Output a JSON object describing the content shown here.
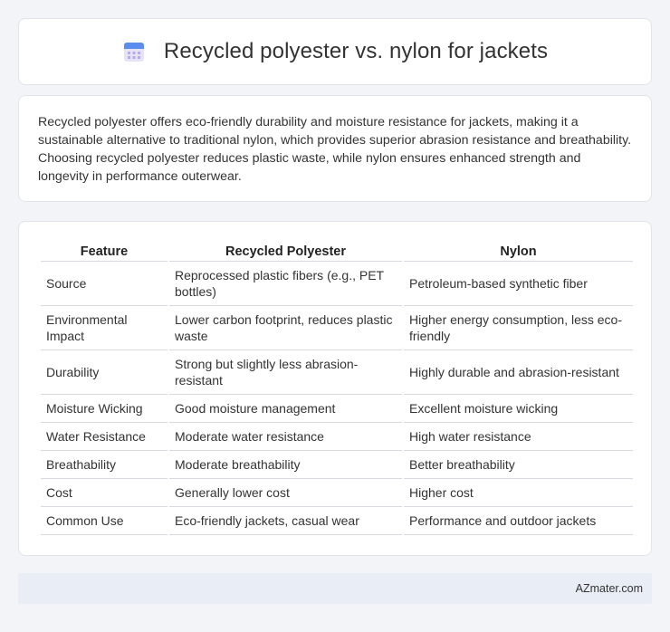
{
  "header": {
    "title": "Recycled polyester vs. nylon for jackets",
    "icon": "calendar-icon"
  },
  "summary": {
    "text": "Recycled polyester offers eco-friendly durability and moisture resistance for jackets, making it a sustainable alternative to traditional nylon, which provides superior abrasion resistance and breathability. Choosing recycled polyester reduces plastic waste, while nylon ensures enhanced strength and longevity in performance outerwear."
  },
  "table": {
    "headers": [
      "Feature",
      "Recycled Polyester",
      "Nylon"
    ],
    "rows": [
      [
        "Source",
        "Reprocessed plastic fibers (e.g., PET bottles)",
        "Petroleum-based synthetic fiber"
      ],
      [
        "Environmental Impact",
        "Lower carbon footprint, reduces plastic waste",
        "Higher energy consumption, less eco-friendly"
      ],
      [
        "Durability",
        "Strong but slightly less abrasion-resistant",
        "Highly durable and abrasion-resistant"
      ],
      [
        "Moisture Wicking",
        "Good moisture management",
        "Excellent moisture wicking"
      ],
      [
        "Water Resistance",
        "Moderate water resistance",
        "High water resistance"
      ],
      [
        "Breathability",
        "Moderate breathability",
        "Better breathability"
      ],
      [
        "Cost",
        "Generally lower cost",
        "Higher cost"
      ],
      [
        "Common Use",
        "Eco-friendly jackets, casual wear",
        "Performance and outdoor jackets"
      ]
    ]
  },
  "footer": {
    "text": "AZmater.com"
  }
}
